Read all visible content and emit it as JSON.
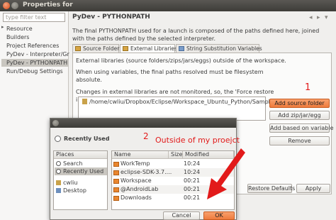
{
  "window": {
    "title": "Properties for"
  },
  "sidebar": {
    "filter_placeholder": "type filter text",
    "items": [
      {
        "label": "Resource"
      },
      {
        "label": "Builders"
      },
      {
        "label": "Project References"
      },
      {
        "label": "PyDev - Interpreter/Gr"
      },
      {
        "label": "PyDev - PYTHONPATH"
      },
      {
        "label": "Run/Debug Settings"
      }
    ]
  },
  "main": {
    "title": "PyDev - PYTHONPATH",
    "description": "The final PYTHONPATH used for a launch is composed of the paths defined here, joined with the paths defined by the selected interpreter.",
    "tabs": [
      {
        "label": "Source Folders"
      },
      {
        "label": "External Libraries"
      },
      {
        "label": "String Substitution Variables"
      }
    ],
    "panel": {
      "line1": "External libraries (source folders/zips/jars/eggs) outside of the workspace.",
      "line2": "When using variables, the final paths resolved must be filesystem absolute.",
      "line3": "Changes in external libraries are not monitored, so, the 'Force restore internal info' should be used if an external library changes."
    },
    "libraries": [
      "/home/cwliu/Dropbox/Eclipse/Workspace_Ubuntu_Python/Sample"
    ],
    "buttons": {
      "add_source_folder": "Add source folder",
      "add_zip": "Add zip/jar/egg",
      "add_based_on_variable": "Add based on variable",
      "remove": "Remove",
      "restore_defaults": "Restore Defaults",
      "apply": "Apply"
    }
  },
  "annotations": {
    "one": "1",
    "two": "2",
    "outside": "Outside of my proejct"
  },
  "dialog": {
    "recently_used": "Recently Used",
    "places_header": "Places",
    "places": [
      {
        "label": "Search"
      },
      {
        "label": "Recently Used"
      },
      {
        "label": "cwliu"
      },
      {
        "label": "Desktop"
      }
    ],
    "columns": {
      "name": "Name",
      "size": "Size",
      "modified": "Modified"
    },
    "files": [
      {
        "name": "WorkTemp",
        "modified": "10:24"
      },
      {
        "name": "eclipse-SDK-3.7....",
        "modified": "10:24"
      },
      {
        "name": "Workspace",
        "modified": "00:21"
      },
      {
        "name": "@AndroidLab",
        "modified": "00:21"
      },
      {
        "name": "Downloads",
        "modified": "00:21"
      }
    ],
    "cancel": "Cancel",
    "ok": "OK"
  },
  "colors": {
    "accent": "#ef7b3d",
    "annotation": "#e21a1a"
  }
}
